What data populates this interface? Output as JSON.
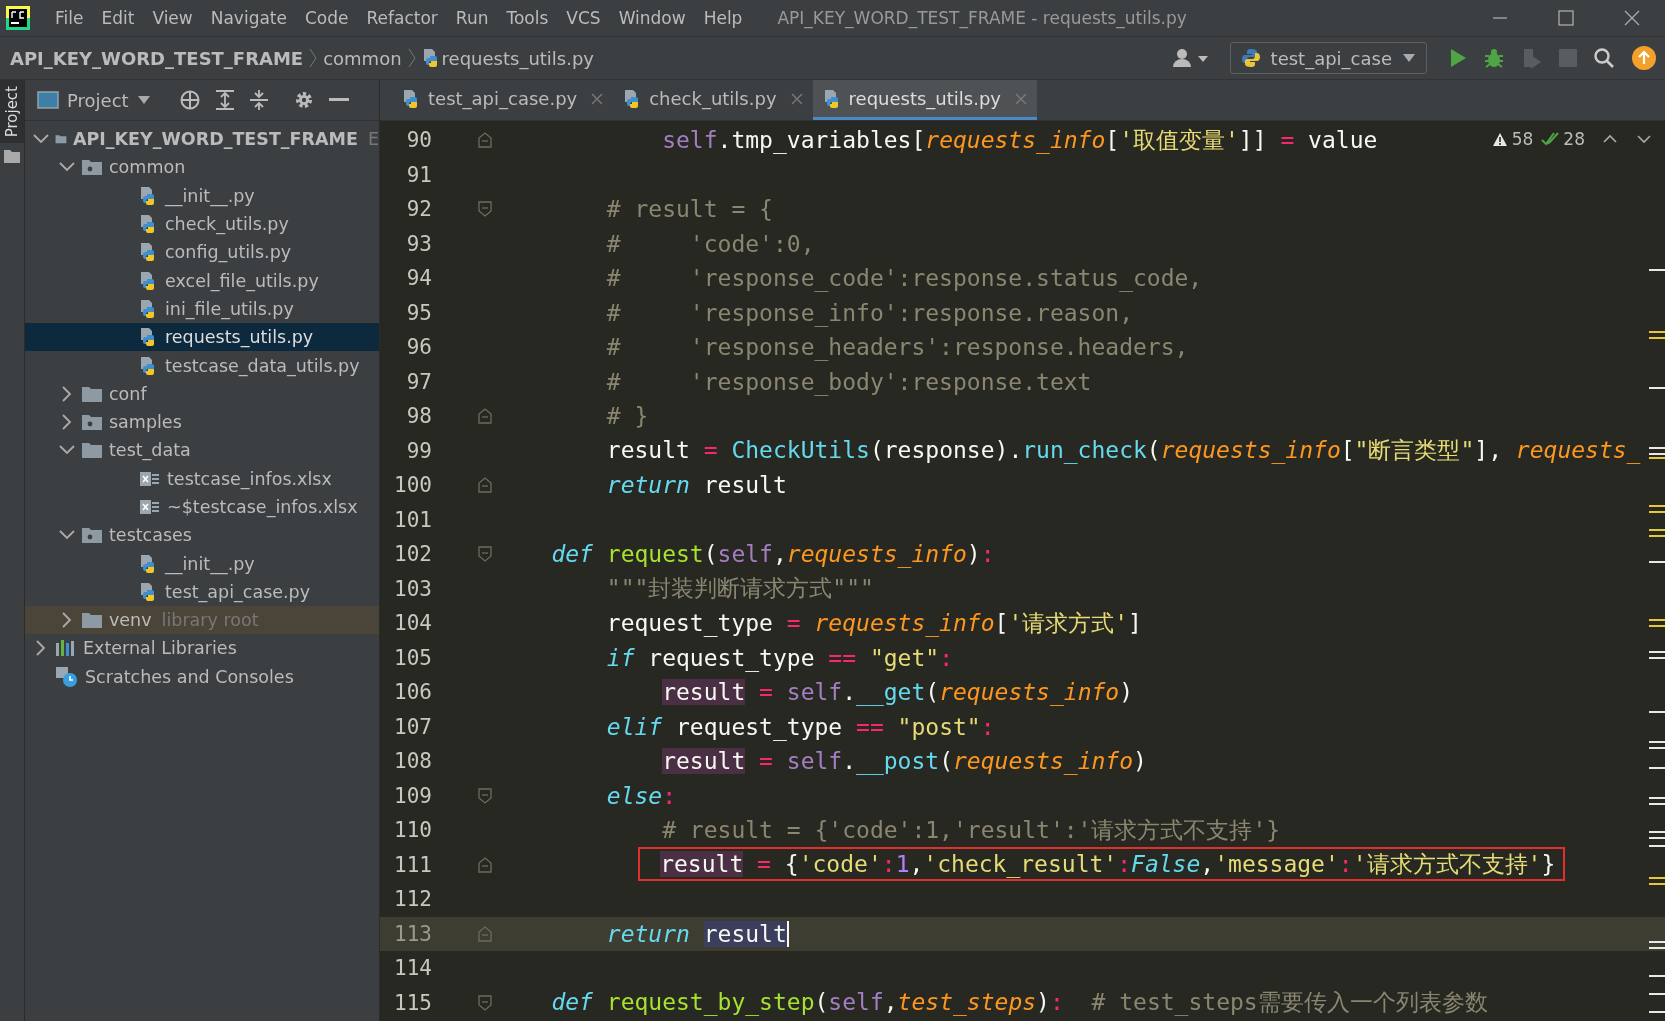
{
  "window": {
    "title": "API_KEY_WORD_TEST_FRAME - requests_utils.py"
  },
  "menu": [
    "File",
    "Edit",
    "View",
    "Navigate",
    "Code",
    "Refactor",
    "Run",
    "Tools",
    "VCS",
    "Window",
    "Help"
  ],
  "breadcrumb": [
    "API_KEY_WORD_TEST_FRAME",
    "common",
    "requests_utils.py"
  ],
  "run_config": "test_api_case",
  "side_strip": "Project",
  "project_panel": {
    "title": "Project",
    "tree": [
      {
        "label": "API_KEY_WORD_TEST_FRAME",
        "suffix": "E",
        "kind": "project",
        "expanded": true,
        "selected": false,
        "children": [
          {
            "label": "common",
            "kind": "package",
            "expanded": true,
            "selected": false,
            "children": [
              {
                "label": "__init__.py",
                "kind": "python",
                "selected": false
              },
              {
                "label": "check_utils.py",
                "kind": "python",
                "selected": false
              },
              {
                "label": "config_utils.py",
                "kind": "python",
                "selected": false
              },
              {
                "label": "excel_file_utils.py",
                "kind": "python",
                "selected": false
              },
              {
                "label": "ini_file_utils.py",
                "kind": "python",
                "selected": false
              },
              {
                "label": "requests_utils.py",
                "kind": "python",
                "selected": true
              },
              {
                "label": "testcase_data_utils.py",
                "kind": "python",
                "selected": false
              }
            ]
          },
          {
            "label": "conf",
            "kind": "folder",
            "expanded": false,
            "selected": false
          },
          {
            "label": "samples",
            "kind": "package",
            "expanded": false,
            "selected": false
          },
          {
            "label": "test_data",
            "kind": "folder",
            "expanded": true,
            "selected": false,
            "children": [
              {
                "label": "testcase_infos.xlsx",
                "kind": "excel",
                "selected": false
              },
              {
                "label": "~$testcase_infos.xlsx",
                "kind": "excel",
                "selected": false
              }
            ]
          },
          {
            "label": "testcases",
            "kind": "package",
            "expanded": true,
            "selected": false,
            "children": [
              {
                "label": "__init__.py",
                "kind": "python",
                "selected": false
              },
              {
                "label": "test_api_case.py",
                "kind": "python",
                "selected": false
              }
            ]
          },
          {
            "label": "venv",
            "suffix": "library root",
            "kind": "library-folder",
            "expanded": false,
            "selected": false
          }
        ]
      },
      {
        "label": "External Libraries",
        "kind": "libraries",
        "expanded": false,
        "selected": false
      },
      {
        "label": "Scratches and Consoles",
        "kind": "scratches",
        "selected": false
      }
    ]
  },
  "tabs": [
    {
      "label": "test_api_case.py",
      "selected": false
    },
    {
      "label": "check_utils.py",
      "selected": false
    },
    {
      "label": "requests_utils.py",
      "selected": true
    }
  ],
  "inspections": {
    "warnings": "58",
    "passed": "28"
  },
  "code": [
    {
      "number": "90",
      "fold_end": true,
      "tokens": [
        {
          "text": "            self",
          "kind": "self"
        },
        {
          "text": ".tmp_variables[",
          "kind": "plain"
        },
        {
          "text": "requests_info",
          "kind": "param"
        },
        {
          "text": "[",
          "kind": "plain"
        },
        {
          "text": "'取值变量'",
          "kind": "string"
        },
        {
          "text": "]] ",
          "kind": "plain"
        },
        {
          "text": "=",
          "kind": "op"
        },
        {
          "text": " value",
          "kind": "plain"
        }
      ]
    },
    {
      "number": "91"
    },
    {
      "number": "92",
      "fold_start": true,
      "tokens": [
        {
          "text": "        # result = {",
          "kind": "comment"
        }
      ]
    },
    {
      "number": "93",
      "tokens": [
        {
          "text": "        #     'code':0,",
          "kind": "comment"
        }
      ]
    },
    {
      "number": "94",
      "tokens": [
        {
          "text": "        #     'response_code':response.status_code,",
          "kind": "comment"
        }
      ]
    },
    {
      "number": "95",
      "tokens": [
        {
          "text": "        #     'response_info':response.reason,",
          "kind": "comment"
        }
      ]
    },
    {
      "number": "96",
      "tokens": [
        {
          "text": "        #     'response_headers':response.headers,",
          "kind": "comment"
        }
      ]
    },
    {
      "number": "97",
      "tokens": [
        {
          "text": "        #     'response_body':response.text",
          "kind": "comment"
        }
      ]
    },
    {
      "number": "98",
      "fold_end": true,
      "tokens": [
        {
          "text": "        # }",
          "kind": "comment"
        }
      ]
    },
    {
      "number": "99",
      "tokens": [
        {
          "text": "        result ",
          "kind": "plain"
        },
        {
          "text": "= ",
          "kind": "op"
        },
        {
          "text": "CheckUtils",
          "kind": "call"
        },
        {
          "text": "(response).",
          "kind": "plain"
        },
        {
          "text": "run_check",
          "kind": "call"
        },
        {
          "text": "(",
          "kind": "plain"
        },
        {
          "text": "requests_info",
          "kind": "param"
        },
        {
          "text": "[",
          "kind": "plain"
        },
        {
          "text": "\"断言类型\"",
          "kind": "string"
        },
        {
          "text": "], ",
          "kind": "plain"
        },
        {
          "text": "requests_",
          "kind": "param"
        }
      ]
    },
    {
      "number": "100",
      "fold_end": true,
      "tokens": [
        {
          "text": "        return",
          "kind": "keyword"
        },
        {
          "text": " result",
          "kind": "plain"
        }
      ]
    },
    {
      "number": "101"
    },
    {
      "number": "102",
      "fold_start": true,
      "tokens": [
        {
          "text": "    def ",
          "kind": "keyword"
        },
        {
          "text": "request",
          "kind": "function"
        },
        {
          "text": "(",
          "kind": "plain"
        },
        {
          "text": "self",
          "kind": "self"
        },
        {
          "text": ",",
          "kind": "plain"
        },
        {
          "text": "requests_info",
          "kind": "param"
        },
        {
          "text": ")",
          "kind": "plain"
        },
        {
          "text": ":",
          "kind": "op"
        }
      ]
    },
    {
      "number": "103",
      "tokens": [
        {
          "text": "        \"\"\"封装判断请求方式\"\"\"",
          "kind": "comment"
        }
      ]
    },
    {
      "number": "104",
      "tokens": [
        {
          "text": "        request_type ",
          "kind": "plain"
        },
        {
          "text": "= ",
          "kind": "op"
        },
        {
          "text": "requests_info",
          "kind": "param"
        },
        {
          "text": "[",
          "kind": "plain"
        },
        {
          "text": "'请求方式'",
          "kind": "string"
        },
        {
          "text": "]",
          "kind": "plain"
        }
      ]
    },
    {
      "number": "105",
      "tokens": [
        {
          "text": "        if",
          "kind": "keyword"
        },
        {
          "text": " request_type ",
          "kind": "plain"
        },
        {
          "text": "== ",
          "kind": "op"
        },
        {
          "text": "\"get\"",
          "kind": "string"
        },
        {
          "text": ":",
          "kind": "op"
        }
      ]
    },
    {
      "number": "106",
      "tokens": [
        {
          "text": "            result",
          "kind": "usage"
        },
        {
          "text": " = ",
          "kind": "op"
        },
        {
          "text": "self",
          "kind": "self"
        },
        {
          "text": ".",
          "kind": "plain"
        },
        {
          "text": "__get",
          "kind": "call"
        },
        {
          "text": "(",
          "kind": "plain"
        },
        {
          "text": "requests_info",
          "kind": "param"
        },
        {
          "text": ")",
          "kind": "plain"
        }
      ]
    },
    {
      "number": "107",
      "tokens": [
        {
          "text": "        elif",
          "kind": "keyword"
        },
        {
          "text": " request_type ",
          "kind": "plain"
        },
        {
          "text": "== ",
          "kind": "op"
        },
        {
          "text": "\"post\"",
          "kind": "string"
        },
        {
          "text": ":",
          "kind": "op"
        }
      ]
    },
    {
      "number": "108",
      "tokens": [
        {
          "text": "            result",
          "kind": "usage"
        },
        {
          "text": " = ",
          "kind": "op"
        },
        {
          "text": "self",
          "kind": "self"
        },
        {
          "text": ".",
          "kind": "plain"
        },
        {
          "text": "__post",
          "kind": "call"
        },
        {
          "text": "(",
          "kind": "plain"
        },
        {
          "text": "requests_info",
          "kind": "param"
        },
        {
          "text": ")",
          "kind": "plain"
        }
      ]
    },
    {
      "number": "109",
      "fold_start": true,
      "tokens": [
        {
          "text": "        else",
          "kind": "keyword"
        },
        {
          "text": ":",
          "kind": "op"
        }
      ]
    },
    {
      "number": "110",
      "tokens": [
        {
          "text": "            # result = {'code':1,'result':'请求方式不支持'}",
          "kind": "comment"
        }
      ]
    },
    {
      "number": "111",
      "fold_end": true,
      "boxed": true,
      "tokens": [
        {
          "text": "            result",
          "kind": "usage"
        },
        {
          "text": " = ",
          "kind": "op"
        },
        {
          "text": "{",
          "kind": "plain"
        },
        {
          "text": "'code'",
          "kind": "string"
        },
        {
          "text": ":",
          "kind": "op"
        },
        {
          "text": "1",
          "kind": "number"
        },
        {
          "text": ",",
          "kind": "plain"
        },
        {
          "text": "'check_result'",
          "kind": "string"
        },
        {
          "text": ":",
          "kind": "op"
        },
        {
          "text": "False",
          "kind": "keyword"
        },
        {
          "text": ",",
          "kind": "plain"
        },
        {
          "text": "'message'",
          "kind": "string"
        },
        {
          "text": ":",
          "kind": "op"
        },
        {
          "text": "'请求方式不支持'",
          "kind": "string"
        },
        {
          "text": "}",
          "kind": "plain"
        }
      ]
    },
    {
      "number": "112"
    },
    {
      "number": "113",
      "fold_end": true,
      "current": true,
      "tokens": [
        {
          "text": "        return ",
          "kind": "keyword"
        },
        {
          "text": "result",
          "kind": "target"
        }
      ]
    },
    {
      "number": "114"
    },
    {
      "number": "115",
      "fold_start": true,
      "tokens": [
        {
          "text": "    def ",
          "kind": "keyword"
        },
        {
          "text": "request_by_step",
          "kind": "function"
        },
        {
          "text": "(",
          "kind": "plain"
        },
        {
          "text": "self",
          "kind": "self"
        },
        {
          "text": ",",
          "kind": "plain"
        },
        {
          "text": "test_steps",
          "kind": "param"
        },
        {
          "text": ")",
          "kind": "plain"
        },
        {
          "text": ":",
          "kind": "op"
        },
        {
          "text": "  # test_steps需要传入一个列表参数",
          "kind": "comment"
        }
      ]
    }
  ]
}
